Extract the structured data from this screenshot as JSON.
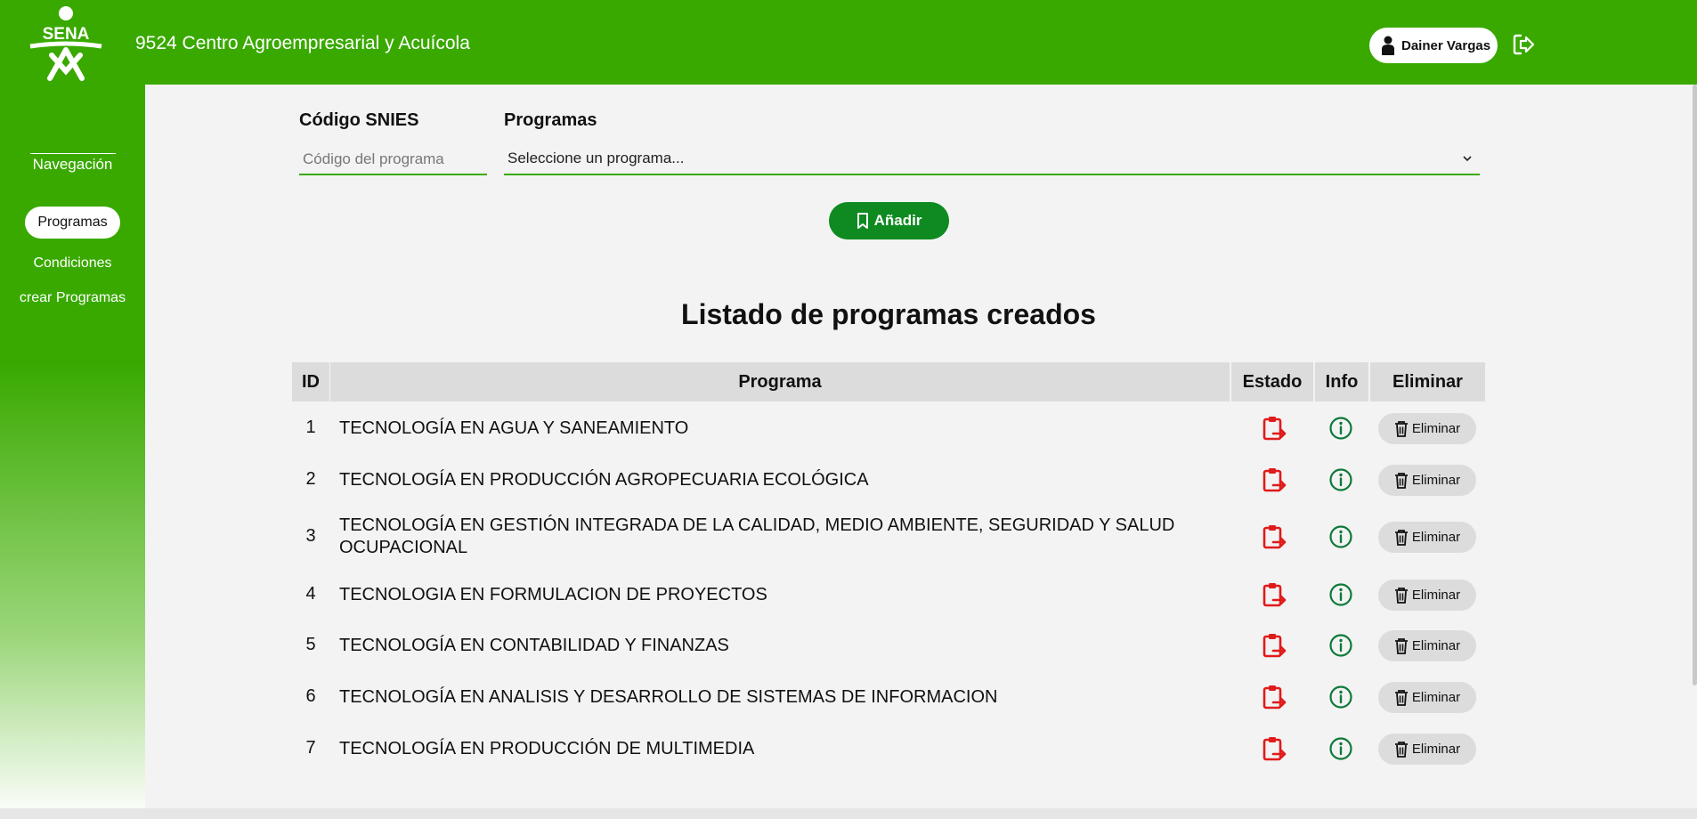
{
  "header": {
    "logo_text": "SENA",
    "center_name": "9524 Centro Agroempresarial y Acuícola",
    "user_name": "Dainer Vargas"
  },
  "sidebar": {
    "title": "Navegación",
    "items": [
      {
        "label": "Programas",
        "active": true
      },
      {
        "label": "Condiciones",
        "active": false
      },
      {
        "label": "crear Programas",
        "active": false
      }
    ]
  },
  "form": {
    "snies_label": "Código SNIES",
    "snies_placeholder": "Código del programa",
    "programas_label": "Programas",
    "programas_selected": "Seleccione un programa...",
    "add_label": "Añadir"
  },
  "list": {
    "title": "Listado de programas creados",
    "columns": [
      "ID",
      "Programa",
      "Estado",
      "Info",
      "Eliminar"
    ],
    "delete_label": "Eliminar",
    "rows": [
      {
        "id": "1",
        "programa": "TECNOLOGÍA EN AGUA Y SANEAMIENTO"
      },
      {
        "id": "2",
        "programa": "TECNOLOGÍA EN PRODUCCIÓN AGROPECUARIA ECOLÓGICA"
      },
      {
        "id": "3",
        "programa": "TECNOLOGÍA EN GESTIÓN INTEGRADA DE LA CALIDAD, MEDIO AMBIENTE, SEGURIDAD Y SALUD OCUPACIONAL"
      },
      {
        "id": "4",
        "programa": "TECNOLOGIA EN FORMULACION DE PROYECTOS"
      },
      {
        "id": "5",
        "programa": "TECNOLOGÍA EN CONTABILIDAD Y FINANZAS"
      },
      {
        "id": "6",
        "programa": "TECNOLOGÍA EN ANALISIS Y DESARROLLO DE SISTEMAS DE INFORMACION"
      },
      {
        "id": "7",
        "programa": "TECNOLOGÍA EN PRODUCCIÓN DE MULTIMEDIA"
      }
    ]
  },
  "colors": {
    "brand_green": "#39a900",
    "button_green": "#0e8a21",
    "estado_red": "#e01b1b",
    "info_green": "#0e7a3a"
  },
  "icons": {
    "estado": "clipboard-arrow-icon",
    "info": "info-circle-icon",
    "delete": "trash-icon",
    "add": "bookmark-icon",
    "user": "user-icon",
    "logout": "logout-icon"
  }
}
